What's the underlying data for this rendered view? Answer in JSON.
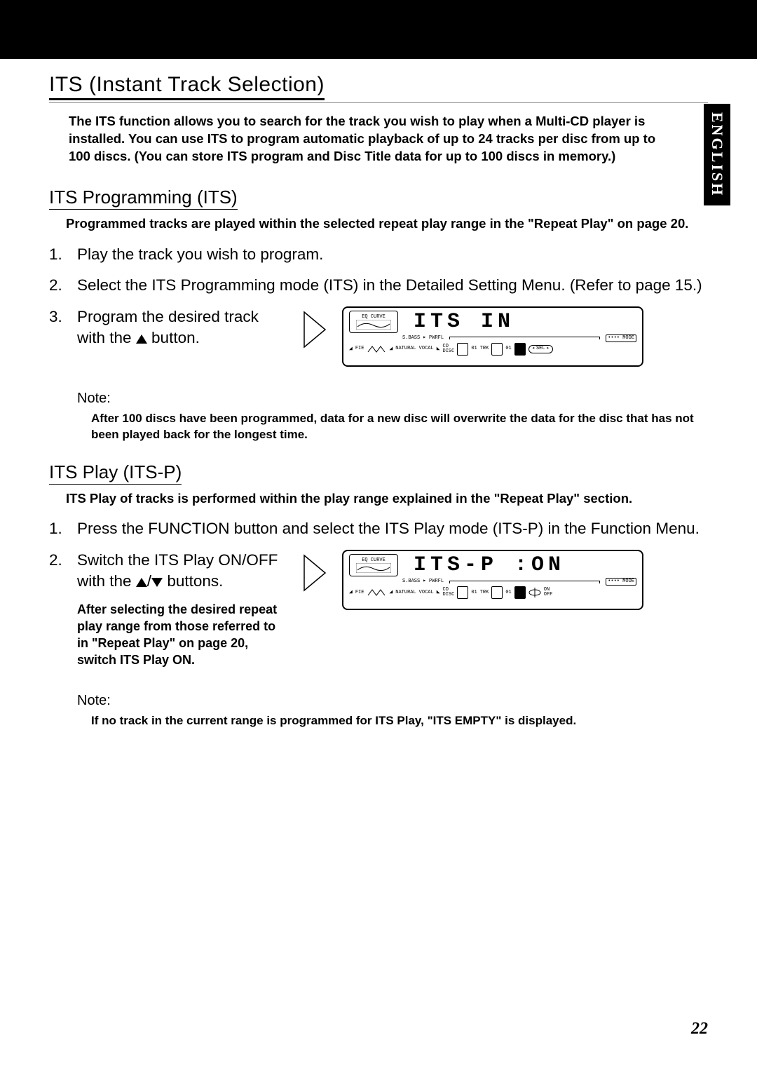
{
  "language_tab": "ENGLISH",
  "page_number": "22",
  "main_heading": "ITS (Instant Track Selection)",
  "intro": "The ITS function allows you to search for the track you wish to play when a Multi-CD player is installed. You can use ITS to program automatic playback of up to 24 tracks per disc from up to 100 discs. (You can store ITS program and Disc Title data for up to 100 discs in memory.)",
  "section1": {
    "heading": "ITS Programming (ITS)",
    "intro": "Programmed tracks are played within the selected repeat play range in the \"Repeat Play\" on page 20.",
    "steps": {
      "s1": "Play the track you wish to program.",
      "s2": "Select the ITS Programming mode (ITS) in the Detailed Setting Menu. (Refer to page 15.)",
      "s3": "Program the desired track with the ",
      "s3b": " button."
    },
    "lcd": {
      "main": "ITS  IN",
      "eq_label": "EQ CURVE",
      "sbass": "S.BASS",
      "pwrfl": "PWRFL",
      "mode": "•••• MODE",
      "fie": "FIE",
      "natural": "NATURAL",
      "vocal": "VOCAL",
      "cd": "CD",
      "disc": "DISC",
      "disc_val": "01",
      "trk": "TRK",
      "trk_val": "01",
      "sel": "SEL"
    },
    "note_label": "Note:",
    "note_body": "After 100 discs have been programmed, data for a new disc will overwrite the data for the disc that has not been played back for the longest time."
  },
  "section2": {
    "heading": "ITS Play (ITS-P)",
    "intro": "ITS Play of tracks is performed within the play range explained in the \"Repeat Play\" section.",
    "steps": {
      "s1": "Press the FUNCTION button and select the ITS Play mode (ITS-P) in the Function Menu.",
      "s2": "Switch the ITS Play ON/OFF with the ",
      "s2b": " buttons."
    },
    "after": "After selecting the desired repeat play range from those referred to in \"Repeat Play\" on page 20, switch ITS Play ON.",
    "lcd": {
      "main": "ITS-P :ON",
      "eq_label": "EQ CURVE",
      "sbass": "S.BASS",
      "pwrfl": "PWRFL",
      "mode": "•••• MODE",
      "fie": "FIE",
      "natural": "NATURAL",
      "vocal": "VOCAL",
      "cd": "CD",
      "disc": "DISC",
      "disc_val": "01",
      "trk": "TRK",
      "trk_val": "01",
      "on": "ON",
      "off": "OFF"
    },
    "note_label": "Note:",
    "note_body": "If no track in the current range is programmed for ITS Play, \"ITS EMPTY\" is displayed."
  }
}
